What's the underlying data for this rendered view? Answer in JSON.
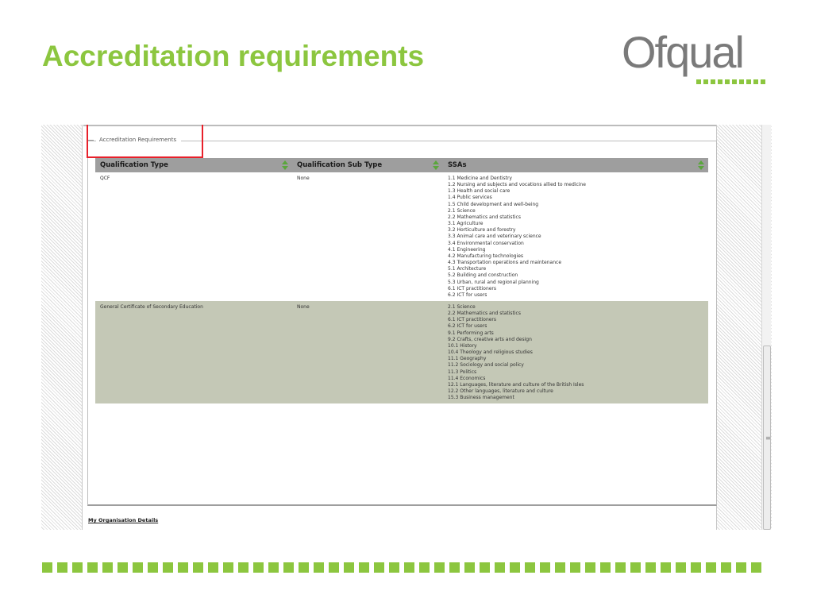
{
  "slide": {
    "title": "Accreditation requirements"
  },
  "logo": {
    "text": "Ofqual",
    "accent_color": "#8cc63f",
    "text_color": "#7a7a7a"
  },
  "panel": {
    "legend": "Accreditation Requirements",
    "columns": [
      "Qualification Type",
      "Qualification Sub Type",
      "SSAs"
    ],
    "rows": [
      {
        "type": "QCF",
        "sub_type": "None",
        "ssas": [
          "1.1 Medicine and Dentistry",
          "1.2 Nursing and subjects and vocations allied to medicine",
          "1.3 Health and social care",
          "1.4 Public services",
          "1.5 Child development and well-being",
          "2.1 Science",
          "2.2 Mathematics and statistics",
          "3.1 Agriculture",
          "3.2 Horticulture and forestry",
          "3.3 Animal care and veterinary science",
          "3.4 Environmental conservation",
          "4.1 Engineering",
          "4.2 Manufacturing technologies",
          "4.3 Transportation operations and maintenance",
          "5.1 Architecture",
          "5.2 Building and construction",
          "5.3 Urban, rural and regional planning",
          "6.1 ICT practitioners",
          "6.2 ICT for users"
        ]
      },
      {
        "type": "General Certificate of Secondary Education",
        "sub_type": "None",
        "ssas": [
          "2.1 Science",
          "2.2 Mathematics and statistics",
          "6.1 ICT practitioners",
          "6.2 ICT for users",
          "9.1 Performing arts",
          "9.2 Crafts, creative arts and design",
          "10.1 History",
          "10.4 Theology and religious studies",
          "11.1 Geography",
          "11.2 Sociology and social policy",
          "11.3 Politics",
          "11.4 Economics",
          "12.1 Languages, literature and culture of the British Isles",
          "12.2 Other languages, literature and culture",
          "15.3 Business management"
        ]
      }
    ],
    "link": "My Organisation Details"
  },
  "colors": {
    "accent": "#8cc63f",
    "header_bg": "#9e9e9e",
    "alt_row_bg": "#c4c8b6",
    "highlight": "#e8202a"
  },
  "icons": {
    "sort": "sort-arrows-icon",
    "scroll_grip": "scroll-grip-icon"
  }
}
